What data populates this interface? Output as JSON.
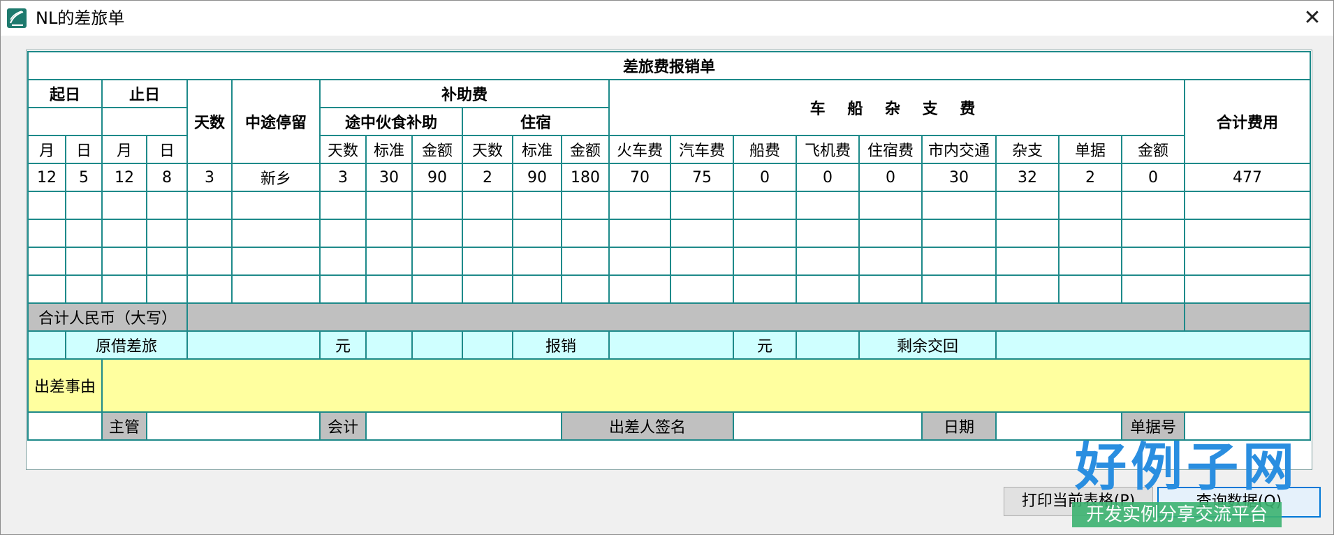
{
  "window": {
    "title": "NL的差旅单",
    "close_glyph": "✕"
  },
  "form": {
    "title": "差旅费报销单",
    "headers": {
      "start_date": "起日",
      "end_date": "止日",
      "days": "天数",
      "stopover": "中途停留",
      "subsidy": "补助费",
      "meal_subsidy": "途中伙食补助",
      "lodging": "住宿",
      "transport": "车 船 杂 支 费",
      "total": "合计费用",
      "month": "月",
      "day": "日",
      "sub_days": "天数",
      "standard": "标准",
      "amount": "金额",
      "train": "火车费",
      "bus": "汽车费",
      "ship": "船费",
      "flight": "飞机费",
      "hotel": "住宿费",
      "city_transport": "市内交通",
      "misc": "杂支",
      "receipts": "单据",
      "t_amount": "金额"
    },
    "rows": [
      [
        "12",
        "5",
        "12",
        "8",
        "3",
        "新乡",
        "3",
        "30",
        "90",
        "2",
        "90",
        "180",
        "70",
        "75",
        "0",
        "0",
        "0",
        "30",
        "32",
        "2",
        "0",
        "477"
      ]
    ],
    "total_rmb_label": "合计人民币（大写）",
    "advance_label": "原借差旅",
    "yuan": "元",
    "reimburse_label": "报销",
    "yuan2": "元",
    "remaining_label": "剩余交回",
    "reason_label": "出差事由",
    "supervisor": "主管",
    "accountant": "会计",
    "traveler_sign": "出差人签名",
    "date": "日期",
    "doc_no": "单据号"
  },
  "buttons": {
    "print": "打印当前表格(P)",
    "query": "查询数据(Q)"
  },
  "watermark": {
    "brand": "好例子网",
    "slogan": "开发实例分享交流平台"
  },
  "colors": {
    "grid": "#1e8a8a",
    "gray": "#c0c0c0",
    "cyan": "#cfffff",
    "yellow": "#ffff9f",
    "red": "#ff0000",
    "brand_blue": "#2a8ee0"
  }
}
